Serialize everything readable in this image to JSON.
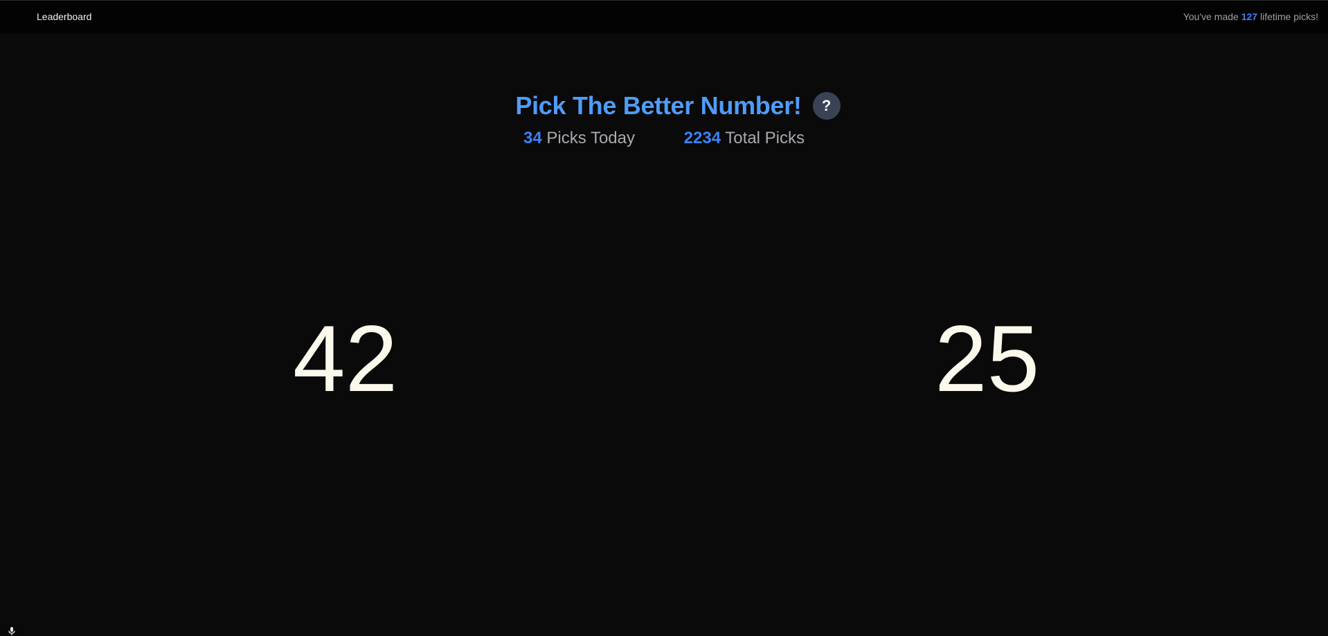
{
  "nav": {
    "leaderboard_label": "Leaderboard",
    "lifetime_prefix": "You've made ",
    "lifetime_count": "127",
    "lifetime_suffix": " lifetime picks!"
  },
  "header": {
    "title": "Pick The Better Number!",
    "help_label": "?"
  },
  "stats": {
    "today_count": "34",
    "today_label": " Picks Today",
    "total_count": "2234",
    "total_label": " Total Picks"
  },
  "choices": {
    "left": "42",
    "right": "25"
  },
  "icons": {
    "help": "question-icon",
    "mic": "microphone-icon"
  },
  "colors": {
    "accent": "#3b82f6",
    "title": "#4f9cf9",
    "background": "#0a0a0a",
    "number": "#fbf8ec"
  }
}
